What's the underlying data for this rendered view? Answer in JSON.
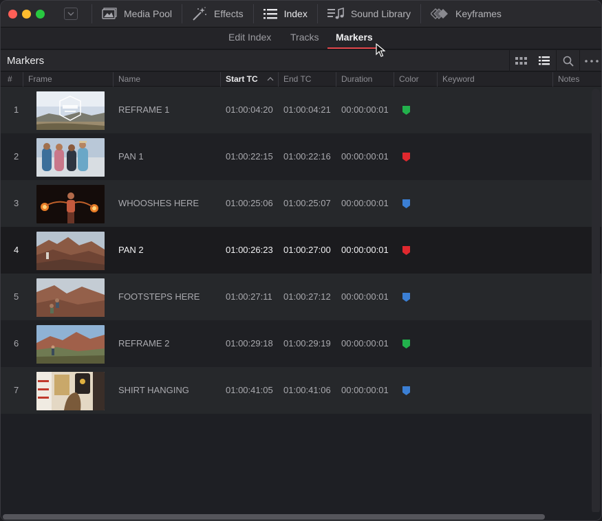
{
  "toolbar": {
    "tools": [
      {
        "label": "Media Pool",
        "icon": "media-pool-icon"
      },
      {
        "label": "Effects",
        "icon": "effects-wand-icon"
      },
      {
        "label": "Index",
        "icon": "index-list-icon",
        "active": true
      },
      {
        "label": "Sound Library",
        "icon": "sound-library-icon"
      },
      {
        "label": "Keyframes",
        "icon": "keyframes-icon"
      }
    ]
  },
  "subtabs": {
    "edit_index": "Edit Index",
    "tracks": "Tracks",
    "markers": "Markers",
    "active": "Markers"
  },
  "panel": {
    "title": "Markers"
  },
  "table": {
    "columns": [
      "#",
      "Frame",
      "Name",
      "Start TC",
      "End TC",
      "Duration",
      "Color",
      "Keyword",
      "Notes"
    ],
    "sorted_column": "Start TC",
    "sort_direction": "ascending",
    "rows": [
      {
        "num": "1",
        "name": "REFRAME 1",
        "start": "01:00:04:20",
        "end": "01:00:04:21",
        "duration": "00:00:00:01",
        "color": "#22b14c",
        "thumb": "desert-logo"
      },
      {
        "num": "2",
        "name": "PAN 1",
        "start": "01:00:22:15",
        "end": "01:00:22:16",
        "duration": "00:00:00:01",
        "color": "#e0282e",
        "thumb": "group-beach"
      },
      {
        "num": "3",
        "name": "WHOOSHES HERE",
        "start": "01:00:25:06",
        "end": "01:00:25:07",
        "duration": "00:00:00:01",
        "color": "#3b7fd4",
        "thumb": "fire-dancer"
      },
      {
        "num": "4",
        "name": "PAN 2",
        "start": "01:00:26:23",
        "end": "01:00:27:00",
        "duration": "00:00:00:01",
        "color": "#e0282e",
        "thumb": "red-rocks",
        "selected": true
      },
      {
        "num": "5",
        "name": "FOOTSTEPS HERE",
        "start": "01:00:27:11",
        "end": "01:00:27:12",
        "duration": "00:00:00:01",
        "color": "#3b7fd4",
        "thumb": "rock-hikers"
      },
      {
        "num": "6",
        "name": "REFRAME 2",
        "start": "01:00:29:18",
        "end": "01:00:29:19",
        "duration": "00:00:00:01",
        "color": "#22b14c",
        "thumb": "mountain-hiker"
      },
      {
        "num": "7",
        "name": "SHIRT HANGING",
        "start": "01:00:41:05",
        "end": "01:00:41:06",
        "duration": "00:00:00:01",
        "color": "#3b7fd4",
        "thumb": "shirt-shop"
      }
    ]
  },
  "colors": {
    "accent_red": "#e5484d",
    "marker_green": "#22b14c",
    "marker_red": "#e0282e",
    "marker_blue": "#3b7fd4"
  }
}
